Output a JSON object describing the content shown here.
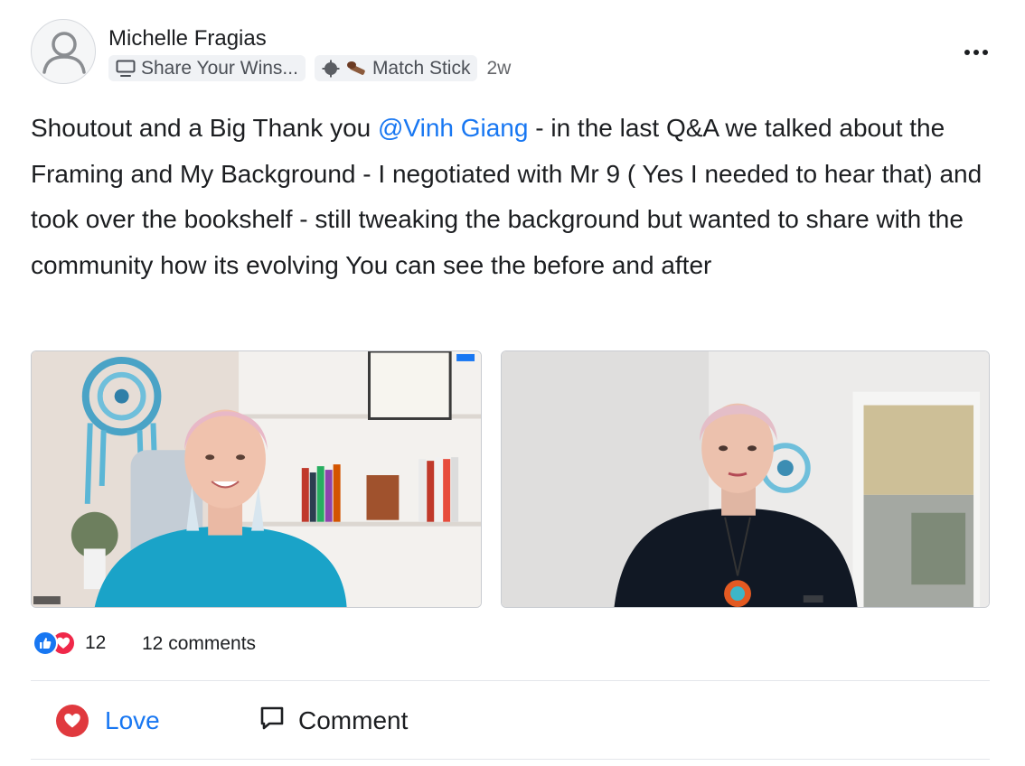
{
  "post": {
    "author": "Michelle Fragias",
    "category": {
      "label": "Share Your Wins...",
      "icon": "monitor-icon"
    },
    "badge": {
      "label": "Match Stick",
      "icon": "match-stick-icon"
    },
    "time": "2w",
    "text_before_mention": "Shoutout and a Big Thank you ",
    "mention": "@Vinh Giang",
    "text_after_mention": " - in the last Q&A we talked about the Framing and My Background - I negotiated with Mr 9 ( Yes I needed to hear that) and took over the bookshelf - still tweaking the background but wanted to share with the community how its evolving You can see the before and after",
    "images": [
      {
        "alt": "Video call screenshot: woman in turquoise top in front of bookshelf and dreamcatcher"
      },
      {
        "alt": "Video call screenshot: woman in dark top in front of plain wall and window"
      }
    ]
  },
  "stats": {
    "reaction_count": "12",
    "comments_label": "12 comments",
    "reaction_icons": [
      "thumbs-up-icon",
      "heart-icon"
    ]
  },
  "actions": {
    "love_label": "Love",
    "comment_label": "Comment"
  },
  "colors": {
    "mention": "#1877f2",
    "like": "#1877f2",
    "love": "#e0393e"
  }
}
